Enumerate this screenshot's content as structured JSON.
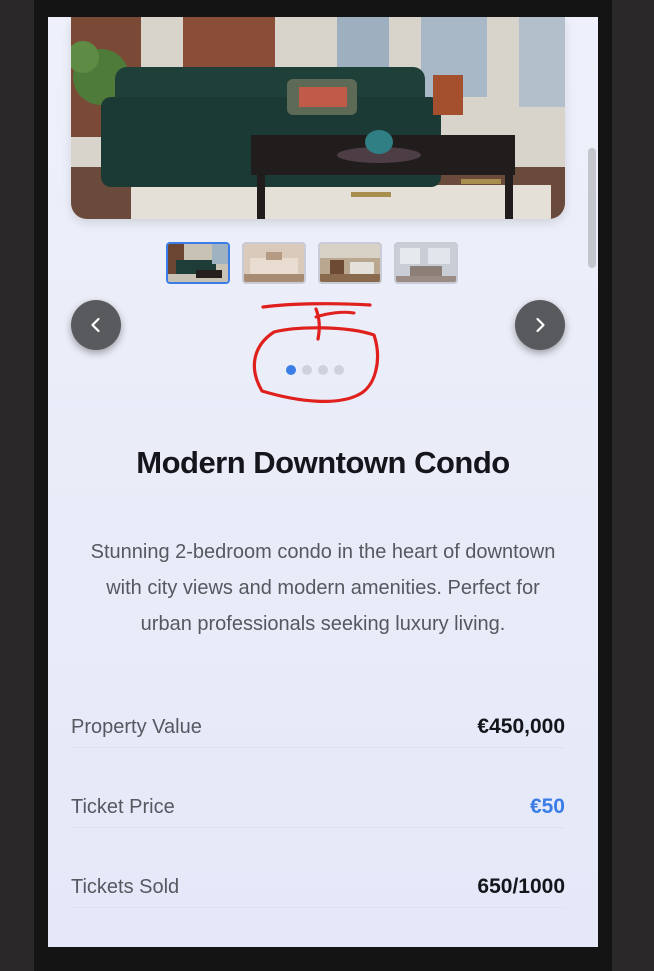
{
  "property": {
    "title": "Modern Downtown Condo",
    "description": "Stunning 2-bedroom condo in the heart of downtown with city views and modern amenities. Perfect for urban professionals seeking luxury living."
  },
  "gallery": {
    "thumbnail_count": 4,
    "active_index": 0,
    "prev_icon": "chevron-left-icon",
    "next_icon": "chevron-right-icon"
  },
  "stats": [
    {
      "label": "Property Value",
      "value": "€450,000"
    },
    {
      "label": "Ticket Price",
      "value": "€50"
    },
    {
      "label": "Tickets Sold",
      "value": "650/1000"
    }
  ],
  "colors": {
    "accent": "#3b7de6",
    "annotation": "#e0201c"
  }
}
